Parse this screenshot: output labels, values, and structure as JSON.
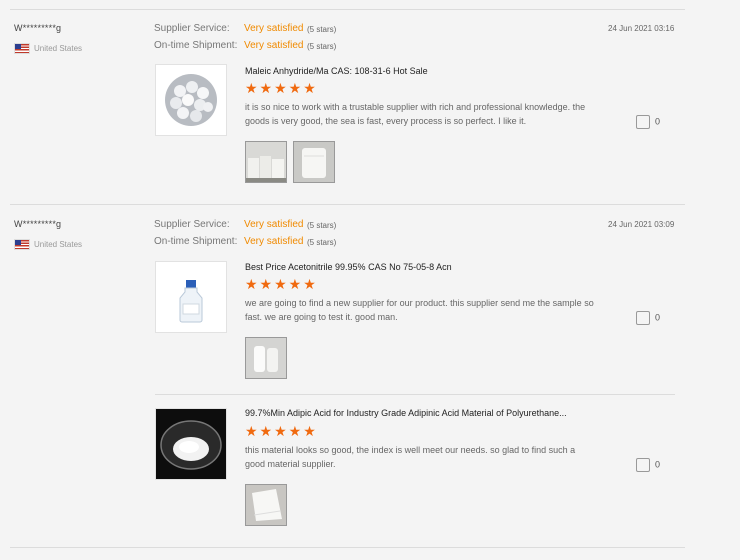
{
  "reviews": [
    {
      "user": "W*********g",
      "country": "United States",
      "supplier_service_label": "Supplier Service:",
      "supplier_service_value": "Very satisfied",
      "supplier_service_stars": "(5 stars)",
      "ontime_label": "On-time Shipment:",
      "ontime_value": "Very satisfied",
      "ontime_stars": "(5 stars)",
      "date": "24 Jun 2021 03:16",
      "products": [
        {
          "title": "Maleic Anhydride/Ma CAS: 108-31-6 Hot Sale",
          "rating": 5,
          "stars": "★★★★★",
          "text": "it is so nice to work with a trustable supplier with rich and professional knowledge. the goods is very good, the sea is fast, every process is so perfect. I like it.",
          "likes": "0",
          "image_icons": [
            "pellets-image"
          ],
          "photos": [
            "warehouse-photo",
            "bag-photo"
          ]
        }
      ]
    },
    {
      "user": "W*********g",
      "country": "United States",
      "supplier_service_label": "Supplier Service:",
      "supplier_service_value": "Very satisfied",
      "supplier_service_stars": "(5 stars)",
      "ontime_label": "On-time Shipment:",
      "ontime_value": "Very satisfied",
      "ontime_stars": "(5 stars)",
      "date": "24 Jun 2021 03:09",
      "products": [
        {
          "title": "Best Price Acetonitrile 99.95% CAS No 75-05-8 Acn",
          "rating": 5,
          "stars": "★★★★★",
          "text": "we are going to find a new supplier for our product. this supplier send me the sample so fast. we are going to test it. good man.",
          "likes": "0",
          "image_icons": [
            "bottle-image"
          ],
          "photos": [
            "white-bottles-photo"
          ]
        },
        {
          "title": "99.7%Min Adipic Acid for Industry Grade Adipinic Acid Material of Polyurethane...",
          "rating": 5,
          "stars": "★★★★★",
          "text": "this material looks so good, the index is well meet our needs. so glad to find such a good material supplier.",
          "likes": "0",
          "image_icons": [
            "powder-dish-image"
          ],
          "photos": [
            "powder-bag-photo"
          ]
        }
      ]
    }
  ],
  "colors": {
    "accent": "#f08a00",
    "star": "#f06a10"
  }
}
